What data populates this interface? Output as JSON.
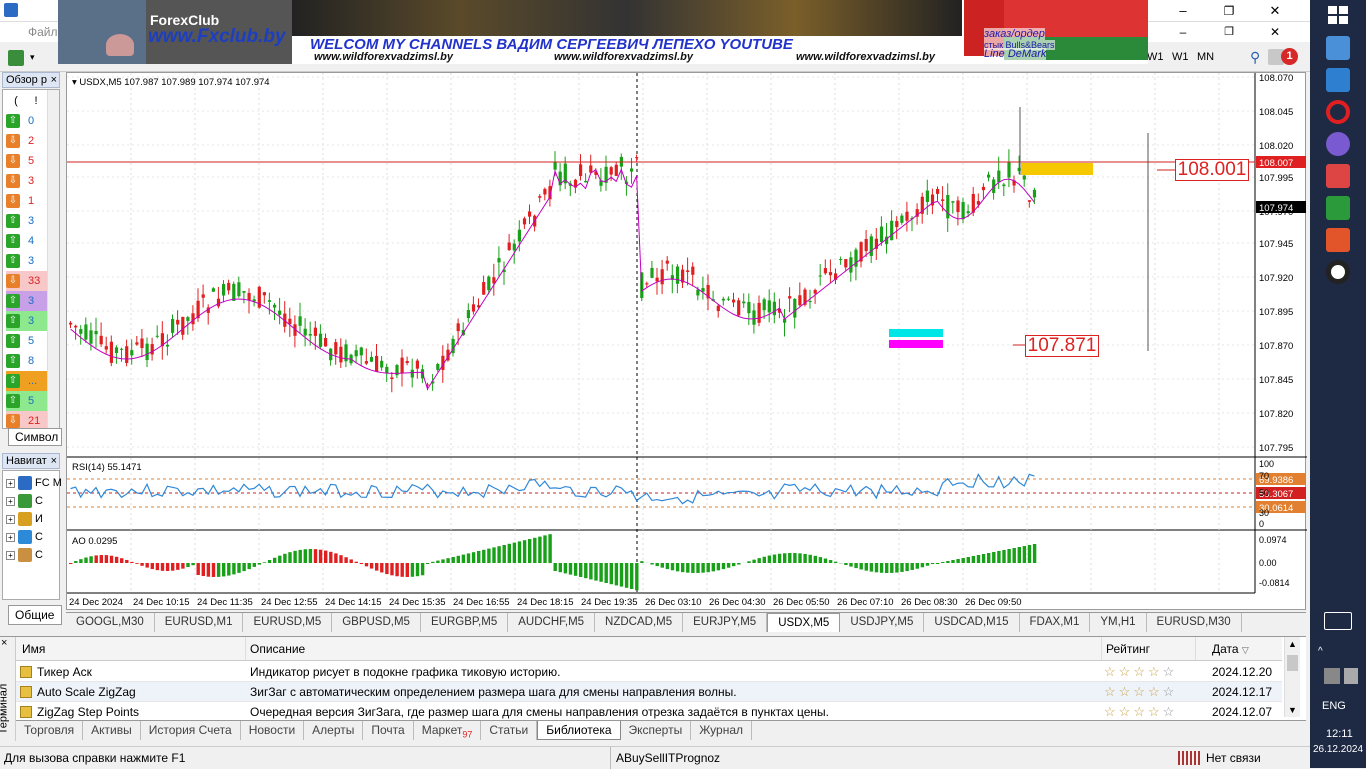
{
  "window": {
    "menu_file": "Файл",
    "controls": {
      "minimize": "–",
      "restore": "❐",
      "close": "✕"
    },
    "toolbar_right": {
      "w1": "W1",
      "mn": "MN"
    },
    "notification_count": "1"
  },
  "banner": {
    "logo": "ForexClub",
    "site": "www.Fxclub.by",
    "headline": "WELCOM MY CHANNELS ВАДИМ СЕРГЕЕВИЧ ЛЕПЕХО YOUTUBE",
    "url1": "www.wildforexvadzimsl.by",
    "url2": "www.wildforexvadzimsl.by",
    "url3": "www.wildforexvadzimsl.by",
    "order": "заказ/ордер",
    "bulls": "стык Bulls&Bears",
    "demark": "Line DeMark"
  },
  "market_watch": {
    "title": "Обзор р",
    "header": [
      "(",
      "!"
    ],
    "rows": [
      {
        "dir": "up",
        "value": "0"
      },
      {
        "dir": "down",
        "value": "2"
      },
      {
        "dir": "down",
        "value": "5"
      },
      {
        "dir": "down",
        "value": "3"
      },
      {
        "dir": "down",
        "value": "1"
      },
      {
        "dir": "up",
        "value": "3"
      },
      {
        "dir": "up",
        "value": "4"
      },
      {
        "dir": "up",
        "value": "3"
      },
      {
        "dir": "down",
        "value": "33"
      },
      {
        "dir": "up",
        "value": "3"
      },
      {
        "dir": "up",
        "value": "3"
      },
      {
        "dir": "up",
        "value": "5"
      },
      {
        "dir": "up",
        "value": "8"
      },
      {
        "dir": "up",
        "value": "..."
      },
      {
        "dir": "up",
        "value": "5"
      },
      {
        "dir": "down",
        "value": "21"
      }
    ],
    "tab_label": "Символ"
  },
  "navigator": {
    "title": "Навигат",
    "items": [
      "FC M",
      "С",
      "И",
      "С",
      "С"
    ],
    "tab_label": "Общие"
  },
  "chart": {
    "info": "USDX,M5  107.987 107.989 107.974 107.974",
    "current_price": "108.007",
    "bid_price": "107.974",
    "level_high": "108.001",
    "level_low": "107.871",
    "price_ticks": [
      "108.070",
      "108.045",
      "108.020",
      "107.995",
      "107.970",
      "107.945",
      "107.920",
      "107.895",
      "107.870",
      "107.845",
      "107.820",
      "107.795"
    ],
    "rsi_label": "RSI(14) 55.1471",
    "rsi_ticks": [
      "100",
      "70",
      "50",
      "30",
      "0"
    ],
    "rsi_levels": [
      "69.9386",
      "50.3067",
      "30.0614"
    ],
    "ao_label": "AO 0.0295",
    "ao_ticks": [
      "0.0974",
      "0.00",
      "-0.0814"
    ],
    "time_ticks": [
      "24 Dec 2024",
      "24 Dec 10:15",
      "24 Dec 11:35",
      "24 Dec 12:55",
      "24 Dec 14:15",
      "24 Dec 15:35",
      "24 Dec 16:55",
      "24 Dec 18:15",
      "24 Dec 19:35",
      "26 Dec 03:10",
      "26 Dec 04:30",
      "26 Dec 05:50",
      "26 Dec 07:10",
      "26 Dec 08:30",
      "26 Dec 09:50"
    ],
    "colors": {
      "bull": "#18a018",
      "bear": "#e02020",
      "ma": "#c000c0",
      "rsi": "#2f88d8",
      "level": "#d22020"
    }
  },
  "symbol_tabs": [
    "GOOGL,M30",
    "EURUSD,M1",
    "EURUSD,M5",
    "GBPUSD,M5",
    "EURGBP,M5",
    "AUDCHF,M5",
    "NZDCAD,M5",
    "EURJPY,M5",
    "USDX,M5",
    "USDJPY,M5",
    "USDCAD,M15",
    "FDAX,M1",
    "YM,H1",
    "EURUSD,M30"
  ],
  "active_symbol_tab": "USDX,M5",
  "terminal": {
    "side_label": "Терминал",
    "columns": {
      "name": "Имя",
      "desc": "Описание",
      "rating": "Рейтинг",
      "date": "Дата"
    },
    "rows": [
      {
        "name": "Тикер Аск",
        "desc": "Индикатор рисует в подокне графика тиковую историю.",
        "date": "2024.12.20"
      },
      {
        "name": "Auto Scale ZigZag",
        "desc": "ЗигЗаг с автоматическим определением размера шага для смены направления волны.",
        "date": "2024.12.17"
      },
      {
        "name": "ZigZag Step Points",
        "desc": "Очередная версия ЗигЗага, где размер шага для смены направления отрезка задаётся в пунктах цены.",
        "date": "2024.12.07"
      }
    ],
    "tabs": [
      "Торговля",
      "Активы",
      "История Счета",
      "Новости",
      "Алерты",
      "Почта",
      "Маркет",
      "Статьи",
      "Библиотека",
      "Эксперты",
      "Журнал"
    ],
    "market_badge": "97",
    "active_tab": "Библиотека"
  },
  "status": {
    "help": "Для вызова справки нажмите F1",
    "profile": "ABuySellITPrognoz",
    "connection": "Нет связи"
  },
  "taskbar": {
    "lang": "ENG",
    "time": "12:11",
    "date": "26.12.2024"
  }
}
